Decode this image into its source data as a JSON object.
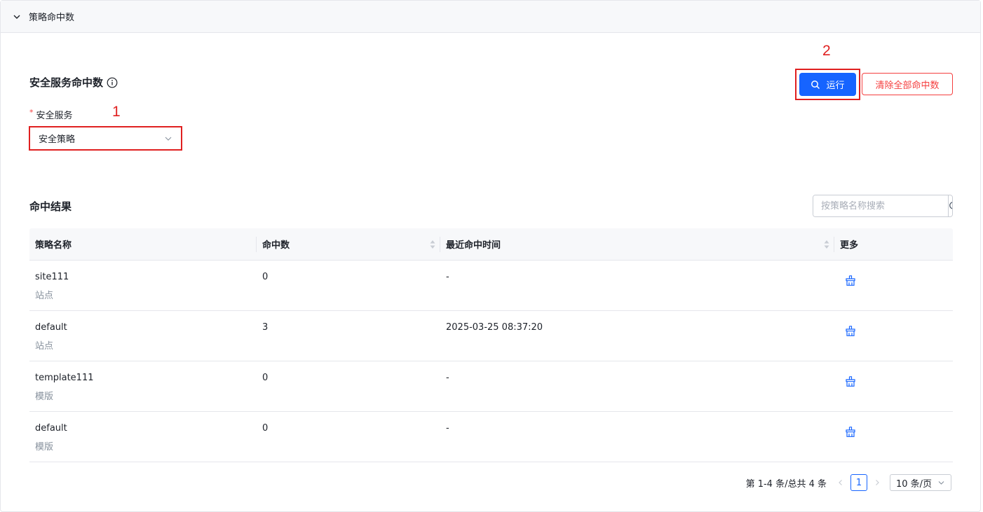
{
  "panel": {
    "title": "策略命中数"
  },
  "section": {
    "title": "安全服务命中数"
  },
  "annotations": {
    "one": "1",
    "two": "2"
  },
  "actions": {
    "run_label": "运行",
    "clear_label": "清除全部命中数"
  },
  "form": {
    "service_label": "安全服务",
    "required_mark": "*",
    "service_value": "安全策略"
  },
  "results": {
    "title": "命中结果",
    "search_placeholder": "按策略名称搜索",
    "columns": [
      "策略名称",
      "命中数",
      "最近命中时间",
      "更多"
    ],
    "rows": [
      {
        "name": "site111",
        "type": "站点",
        "hits": "0",
        "last_time": "-"
      },
      {
        "name": "default",
        "type": "站点",
        "hits": "3",
        "last_time": "2025-03-25 08:37:20"
      },
      {
        "name": "template111",
        "type": "模版",
        "hits": "0",
        "last_time": "-"
      },
      {
        "name": "default",
        "type": "模版",
        "hits": "0",
        "last_time": "-"
      }
    ]
  },
  "pagination": {
    "summary": "第 1-4 条/总共 4 条",
    "current_page": "1",
    "page_size": "10 条/页"
  },
  "colors": {
    "primary": "#1664ff",
    "danger": "#f53f3f",
    "annotation": "#e02020"
  }
}
